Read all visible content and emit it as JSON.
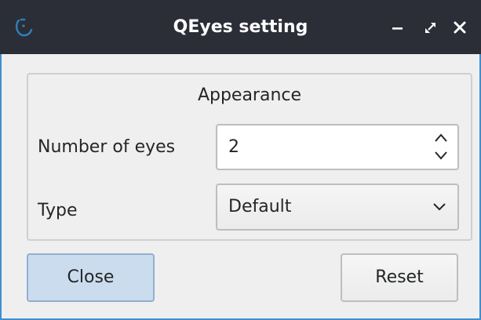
{
  "window": {
    "title": "QEyes setting",
    "accent_color": "#3d8fd1",
    "titlebar_color": "#2b2e37"
  },
  "titlebar": {
    "app_icon": "qeyes-app-icon",
    "minimize_icon": "minimize-icon",
    "maximize_icon": "maximize-icon",
    "close_icon": "close-icon"
  },
  "appearance": {
    "group_title": "Appearance",
    "number_of_eyes_label": "Number of eyes",
    "number_of_eyes_value": "2",
    "type_label": "Type",
    "type_value": "Default"
  },
  "buttons": {
    "close_label": "Close",
    "reset_label": "Reset"
  }
}
